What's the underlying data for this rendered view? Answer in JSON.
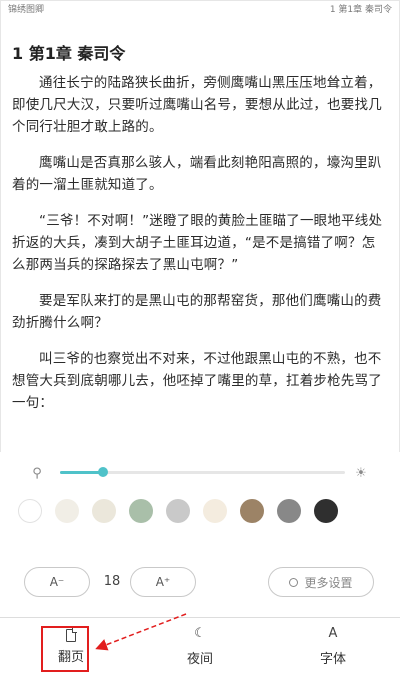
{
  "statusbar": {
    "book_title": "锦绣图卿",
    "chapter_indicator": "1 第1章 秦司令"
  },
  "chapter": {
    "title": "1 第1章 秦司令"
  },
  "paragraphs": [
    "通往长宁的陆路狭长曲折，旁侧鹰嘴山黑压压地耸立着，即使几尺大汉，只要听过鹰嘴山名号，要想从此过，也要找几个同行壮胆才敢上路的。",
    "鹰嘴山是否真那么骇人，端看此刻艳阳高照的，壕沟里趴着的一溜土匪就知道了。",
    "“三爷！不对啊！”迷瞪了眼的黄脸土匪瞄了一眼地平线处折返的大兵，凑到大胡子土匪耳边道，“是不是搞错了啊？怎么那两当兵的探路探去了黑山屯啊？”",
    "要是军队来打的是黑山屯的那帮窑货，那他们鹰嘴山的费劲折腾什么啊？",
    "叫三爷的也察觉出不对来，不过他跟黑山屯的不熟，也不想管大兵到底朝哪儿去，他呸掉了嘴里的草，扛着步枪先骂了一句："
  ],
  "settings": {
    "brightness": 0.15,
    "swatch_colors": [
      "#ffffff",
      "#f1eee6",
      "#ebe7db",
      "#a9bfa9",
      "#c9c9c9",
      "#f4ecdf",
      "#9c8366",
      "#888888",
      "#2f2f2f"
    ],
    "font_decrease_label": "A⁻",
    "font_size": "18",
    "font_increase_label": "A⁺",
    "more_settings_label": "更多设置"
  },
  "bottom_nav": [
    {
      "label": "翻页",
      "icon": "page-turn-icon"
    },
    {
      "label": "夜间",
      "icon": "moon-icon"
    },
    {
      "label": "字体",
      "icon": "font-icon"
    }
  ],
  "annotation_color": "#e21e1e"
}
